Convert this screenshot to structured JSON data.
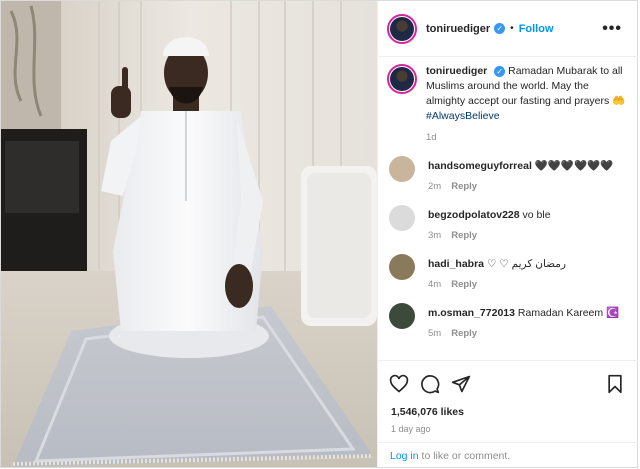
{
  "post": {
    "username": "toniruediger",
    "follow_label": "Follow",
    "dot": "•",
    "more_label": "•••",
    "verified_glyph": "✓"
  },
  "caption": {
    "username": "toniruediger",
    "text": "Ramadan Mubarak to all Muslims around the world. May the almighty accept our fasting and prayers 🤲",
    "hashtag": "#AlwaysBelieve",
    "time": "1d"
  },
  "comments": [
    {
      "username": "handsomeguyforreal",
      "text": "🖤🖤🖤🖤🖤🖤",
      "time": "2m",
      "reply": "Reply",
      "avatar_color": "#c9b59c"
    },
    {
      "username": "begzodpolatov228",
      "text": "vo ble",
      "time": "3m",
      "reply": "Reply",
      "avatar_color": "#dbdbdb"
    },
    {
      "username": "hadi_habra",
      "text": "♡ ♡ رمضان كريم",
      "time": "4m",
      "reply": "Reply",
      "avatar_color": "#8a7a5c"
    },
    {
      "username": "m.osman_772013",
      "text": "Ramadan Kareem ☪️",
      "time": "5m",
      "reply": "Reply",
      "avatar_color": "#3b4a3a"
    }
  ],
  "actions": {
    "like_icon": "heart-icon",
    "comment_icon": "comment-icon",
    "share_icon": "share-icon",
    "save_icon": "bookmark-icon",
    "likes": "1,546,076 likes",
    "time_ago": "1 day ago"
  },
  "login": {
    "link": "Log in",
    "text": " to like or comment."
  },
  "colors": {
    "accent": "#0095f6",
    "verified": "#3897f0",
    "muted": "#8e8e8e",
    "border": "#dbdbdb"
  }
}
